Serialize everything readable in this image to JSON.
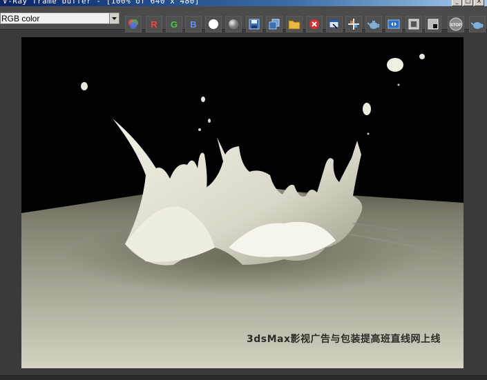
{
  "window": {
    "title": "V-Ray frame buffer - [100% of 640 x 480]",
    "minimize": "_",
    "maximize": "□",
    "close": "X"
  },
  "toolbar": {
    "channel_value": "RGB color",
    "red_label": "R",
    "green_label": "G",
    "blue_label": "B",
    "stop_label": "STOP"
  },
  "viewport": {
    "watermark": "3dsMax影视广告与包装提高班直线网上线"
  }
}
